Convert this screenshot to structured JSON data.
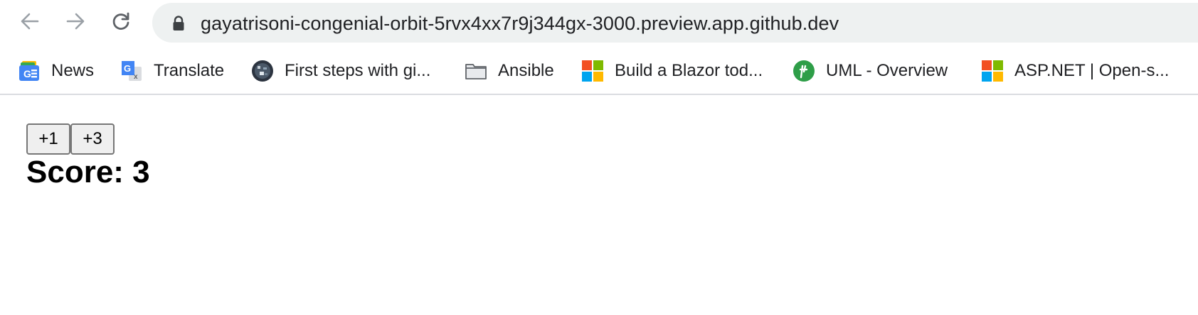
{
  "browser": {
    "url": "gayatrisoni-congenial-orbit-5rvx4xx7r9j344gx-3000.preview.app.github.dev",
    "bookmarks": [
      {
        "label": "News",
        "icon": "google-news-icon"
      },
      {
        "label": "Translate",
        "icon": "google-translate-icon"
      },
      {
        "label": "First steps with gi...",
        "icon": "github-avatar-icon"
      },
      {
        "label": "Ansible",
        "icon": "folder-icon"
      },
      {
        "label": "Build a Blazor tod...",
        "icon": "microsoft-logo-icon"
      },
      {
        "label": "UML - Overview",
        "icon": "uml-logo-icon"
      },
      {
        "label": "ASP.NET | Open-s...",
        "icon": "microsoft-logo-icon"
      }
    ]
  },
  "page": {
    "buttons": {
      "plus_one": "+1",
      "plus_three": "+3"
    },
    "score_text": "Score: 3"
  },
  "colors": {
    "omnibox_bg": "#eef1f1",
    "microsoft_red": "#f25022",
    "microsoft_green": "#7fba00",
    "microsoft_blue": "#00a4ef",
    "microsoft_yellow": "#ffb900",
    "uml_green": "#2e9e48"
  }
}
